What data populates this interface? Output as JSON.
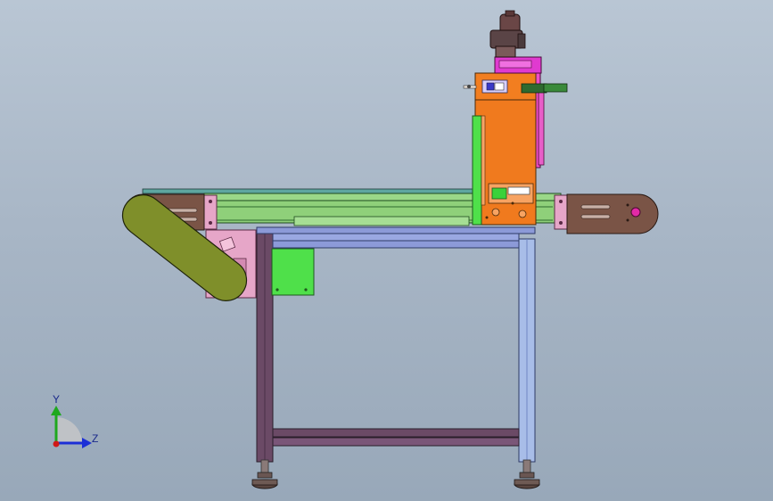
{
  "triad": {
    "y_label": "Y",
    "z_label": "Z",
    "y_axis_color": "#1ea81e",
    "z_axis_color": "#1c2fd6",
    "x_dot_color": "#d01818"
  },
  "colors": {
    "background_top": "#b9c6d4",
    "background_bottom": "#98a8b9",
    "frame_leg_front": "#6b4a66",
    "frame_leg_back": "#9fb4e4",
    "frame_top_rail": "#8c9ad8",
    "conveyor_body": "#8fd07a",
    "conveyor_belt_incline": "#7f8f2a",
    "end_plate": "#7a5446",
    "pink_bracket": "#e6a6c8",
    "orange_column": "#f07a1e",
    "magenta_panel": "#e03ad0",
    "green_box": "#4fe04a",
    "foot_pad": "#5a4640"
  }
}
